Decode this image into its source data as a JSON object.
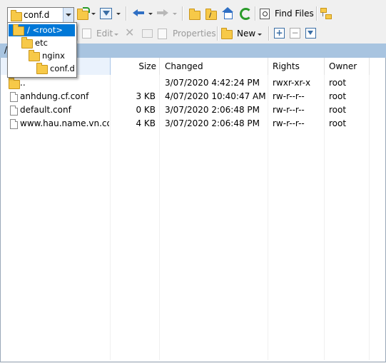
{
  "path_combo": {
    "value": "conf.d"
  },
  "dropdown": {
    "items": [
      {
        "label": "/ <root>"
      },
      {
        "label": "etc"
      },
      {
        "label": "nginx"
      },
      {
        "label": "conf.d"
      }
    ]
  },
  "toolbar": {
    "find_files": "Find Files",
    "edit": "Edit",
    "properties": "Properties",
    "new": "New"
  },
  "address": {
    "text": "/"
  },
  "columns": {
    "name": "",
    "size": "Size",
    "changed": "Changed",
    "rights": "Rights",
    "owner": "Owner"
  },
  "rows": [
    {
      "name": "..",
      "size": "",
      "changed": "3/07/2020 4:42:24 PM",
      "rights": "rwxr-xr-x",
      "owner": "root",
      "icon": "parent-folder-icon"
    },
    {
      "name": "anhdung.cf.conf",
      "size": "3 KB",
      "changed": "4/07/2020 10:40:47 AM",
      "rights": "rw-r--r--",
      "owner": "root",
      "icon": "file-icon"
    },
    {
      "name": "default.conf",
      "size": "0 KB",
      "changed": "3/07/2020 2:06:48 PM",
      "rights": "rw-r--r--",
      "owner": "root",
      "icon": "file-icon"
    },
    {
      "name": "www.hau.name.vn.co...",
      "size": "4 KB",
      "changed": "3/07/2020 2:06:48 PM",
      "rights": "rw-r--r--",
      "owner": "root",
      "icon": "file-icon"
    }
  ]
}
